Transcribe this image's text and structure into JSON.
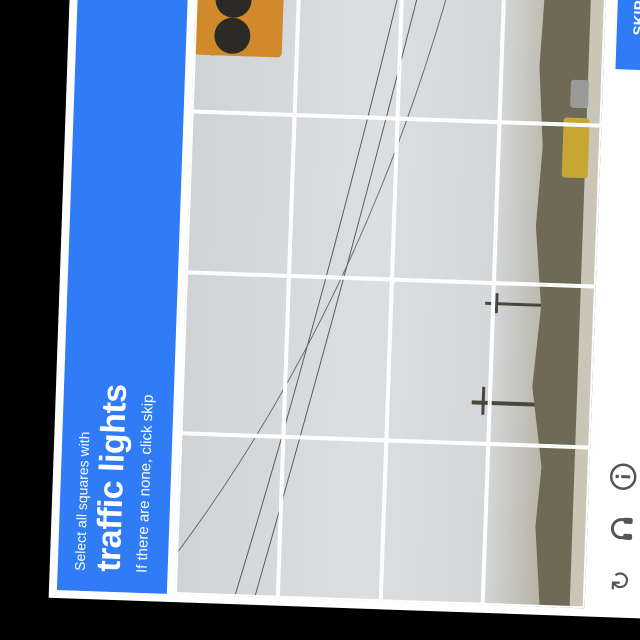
{
  "header": {
    "instruction_line1": "Select all squares with",
    "target_object": "traffic lights",
    "instruction_line3": "If there are none, click skip"
  },
  "grid": {
    "rows": 4,
    "cols": 4,
    "tiles": [
      {
        "row": 0,
        "col": 0
      },
      {
        "row": 0,
        "col": 1
      },
      {
        "row": 0,
        "col": 2
      },
      {
        "row": 0,
        "col": 3
      },
      {
        "row": 1,
        "col": 0
      },
      {
        "row": 1,
        "col": 1
      },
      {
        "row": 1,
        "col": 2
      },
      {
        "row": 1,
        "col": 3
      },
      {
        "row": 2,
        "col": 0
      },
      {
        "row": 2,
        "col": 1
      },
      {
        "row": 2,
        "col": 2
      },
      {
        "row": 2,
        "col": 3
      },
      {
        "row": 3,
        "col": 0
      },
      {
        "row": 3,
        "col": 1
      },
      {
        "row": 3,
        "col": 2
      },
      {
        "row": 3,
        "col": 3
      }
    ]
  },
  "footer": {
    "reload_icon": "reload-icon",
    "audio_icon": "headphones-icon",
    "info_icon": "info-icon",
    "skip_label": "SKIP"
  },
  "colors": {
    "accent": "#2f7cf6",
    "traffic_light_housing": "#d08a2c",
    "green_signal": "#19b97a"
  }
}
